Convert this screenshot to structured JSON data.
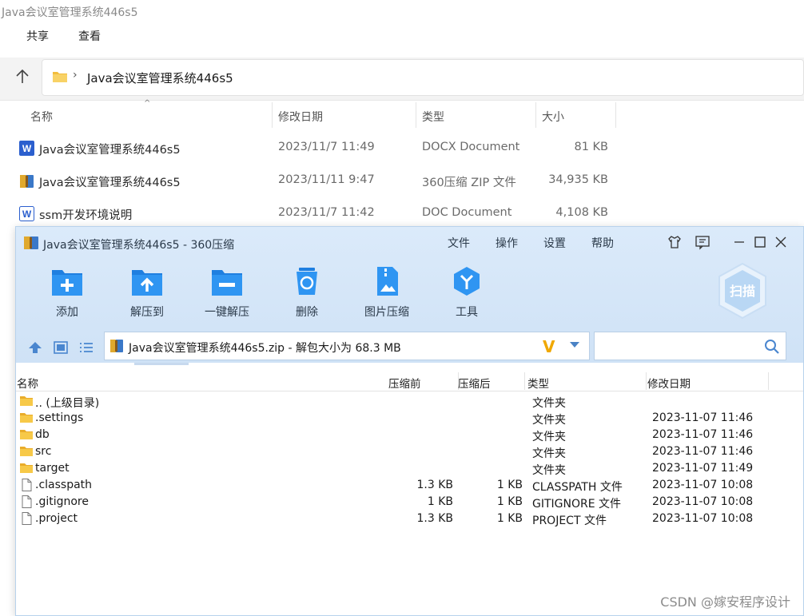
{
  "explorer": {
    "window_title": "Java会议室管理系统446s5",
    "menu": [
      "共享",
      "查看"
    ],
    "address": "Java会议室管理系统446s5",
    "columns": {
      "name": "名称",
      "modified": "修改日期",
      "type": "类型",
      "size": "大小"
    },
    "files": [
      {
        "icon": "word-docx-icon",
        "name": "Java会议室管理系统446s5",
        "modified": "2023/11/7 11:49",
        "type": "DOCX Document",
        "size": "81 KB"
      },
      {
        "icon": "zip-archive-icon",
        "name": "Java会议室管理系统446s5",
        "modified": "2023/11/11 9:47",
        "type": "360压缩 ZIP 文件",
        "size": "34,935 KB"
      },
      {
        "icon": "word-doc-icon",
        "name": "ssm开发环境说明",
        "modified": "2023/11/7 11:42",
        "type": "DOC Document",
        "size": "4,108 KB"
      }
    ]
  },
  "zip": {
    "title": "Java会议室管理系统446s5 - 360压缩",
    "menu": [
      "文件",
      "操作",
      "设置",
      "帮助"
    ],
    "toolbar": [
      "添加",
      "解压到",
      "一键解压",
      "删除",
      "图片压缩",
      "工具"
    ],
    "scan_label": "扫描",
    "path": "Java会议室管理系统446s5.zip - 解包大小为 68.3 MB",
    "search_placeholder": "",
    "columns": {
      "name": "名称",
      "before": "压缩前",
      "after": "压缩后",
      "type": "类型",
      "modified": "修改日期"
    },
    "rows": [
      {
        "icon": "folder-icon",
        "name": ".. (上级目录)",
        "before": "",
        "after": "",
        "type": "文件夹",
        "modified": ""
      },
      {
        "icon": "folder-icon",
        "name": ".settings",
        "before": "",
        "after": "",
        "type": "文件夹",
        "modified": "2023-11-07 11:46"
      },
      {
        "icon": "folder-icon",
        "name": "db",
        "before": "",
        "after": "",
        "type": "文件夹",
        "modified": "2023-11-07 11:46"
      },
      {
        "icon": "folder-icon",
        "name": "src",
        "before": "",
        "after": "",
        "type": "文件夹",
        "modified": "2023-11-07 11:46"
      },
      {
        "icon": "folder-icon",
        "name": "target",
        "before": "",
        "after": "",
        "type": "文件夹",
        "modified": "2023-11-07 11:49"
      },
      {
        "icon": "file-icon",
        "name": ".classpath",
        "before": "1.3 KB",
        "after": "1 KB",
        "type": "CLASSPATH 文件",
        "modified": "2023-11-07 10:08"
      },
      {
        "icon": "file-icon",
        "name": ".gitignore",
        "before": "1 KB",
        "after": "1 KB",
        "type": "GITIGNORE 文件",
        "modified": "2023-11-07 10:08"
      },
      {
        "icon": "file-icon",
        "name": ".project",
        "before": "1.3 KB",
        "after": "1 KB",
        "type": "PROJECT 文件",
        "modified": "2023-11-07 10:08"
      }
    ]
  },
  "watermark": "CSDN @嫁安程序设计",
  "colors": {
    "accent_blue": "#1e88e5",
    "folder_yellow": "#f5c242",
    "zip_header": "#d6e7f8"
  }
}
